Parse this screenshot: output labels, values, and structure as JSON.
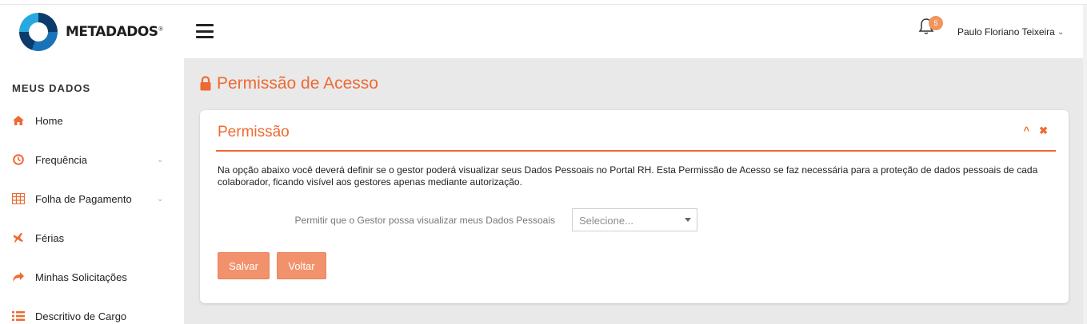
{
  "brand": {
    "name": "METADADOS",
    "mark": "®"
  },
  "header": {
    "notifications_count": "5",
    "user_name": "Paulo Floriano Teixeira",
    "user_chevron": "⌄"
  },
  "sidebar": {
    "title": "MEUS DADOS",
    "items": [
      {
        "label": "Home",
        "icon": "home-icon"
      },
      {
        "label": "Frequência",
        "icon": "clock-icon",
        "has_submenu": true
      },
      {
        "label": "Folha de Pagamento",
        "icon": "calculator-icon",
        "has_submenu": true
      },
      {
        "label": "Férias",
        "icon": "plane-icon"
      },
      {
        "label": "Minhas Solicitações",
        "icon": "share-icon"
      },
      {
        "label": "Descritivo de Cargo",
        "icon": "list-icon"
      }
    ],
    "submenu_arrow": "⌄"
  },
  "page": {
    "title": "Permissão de Acesso"
  },
  "panel": {
    "title": "Permissão",
    "collapse_glyph": "^",
    "close_glyph": "✖",
    "description": "Na opção abaixo você deverá definir se o gestor poderá visualizar seus Dados Pessoais no Portal RH. Esta Permissão de Acesso se faz necessária para a proteção de dados pessoais de cada colaborador, ficando visível aos gestores apenas mediante autorização.",
    "form": {
      "label": "Permitir que o Gestor possa visualizar meus Dados Pessoais",
      "select_value": "Selecione..."
    },
    "buttons": {
      "save": "Salvar",
      "back": "Voltar"
    }
  },
  "colors": {
    "accent": "#ee6a32",
    "button": "#f2926c",
    "content_bg": "#e9e9ea",
    "badge": "#f0955e"
  }
}
